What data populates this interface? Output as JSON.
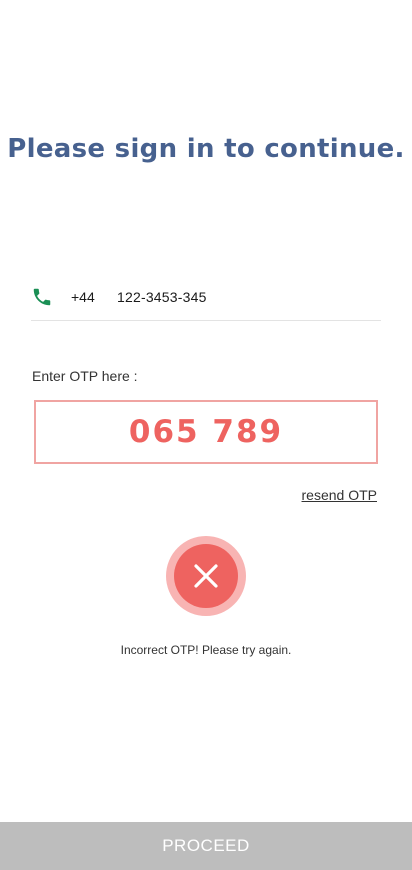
{
  "heading": "Please sign in to continue.",
  "phone": {
    "icon": "phone-icon",
    "icon_color": "#1a8f55",
    "country_code": "+44",
    "number": "122-3453-345"
  },
  "otp": {
    "label": "Enter OTP here :",
    "value": "065 789",
    "value_color": "#ee6360",
    "border_color": "#f0a4a2"
  },
  "resend_label": "resend OTP",
  "error": {
    "icon": "error-x-icon",
    "color": "#ee6360",
    "message": "Incorrect OTP! Please try again."
  },
  "proceed_label": "PROCEED",
  "colors": {
    "heading": "#47618f",
    "proceed_background": "#bdbdbd"
  }
}
